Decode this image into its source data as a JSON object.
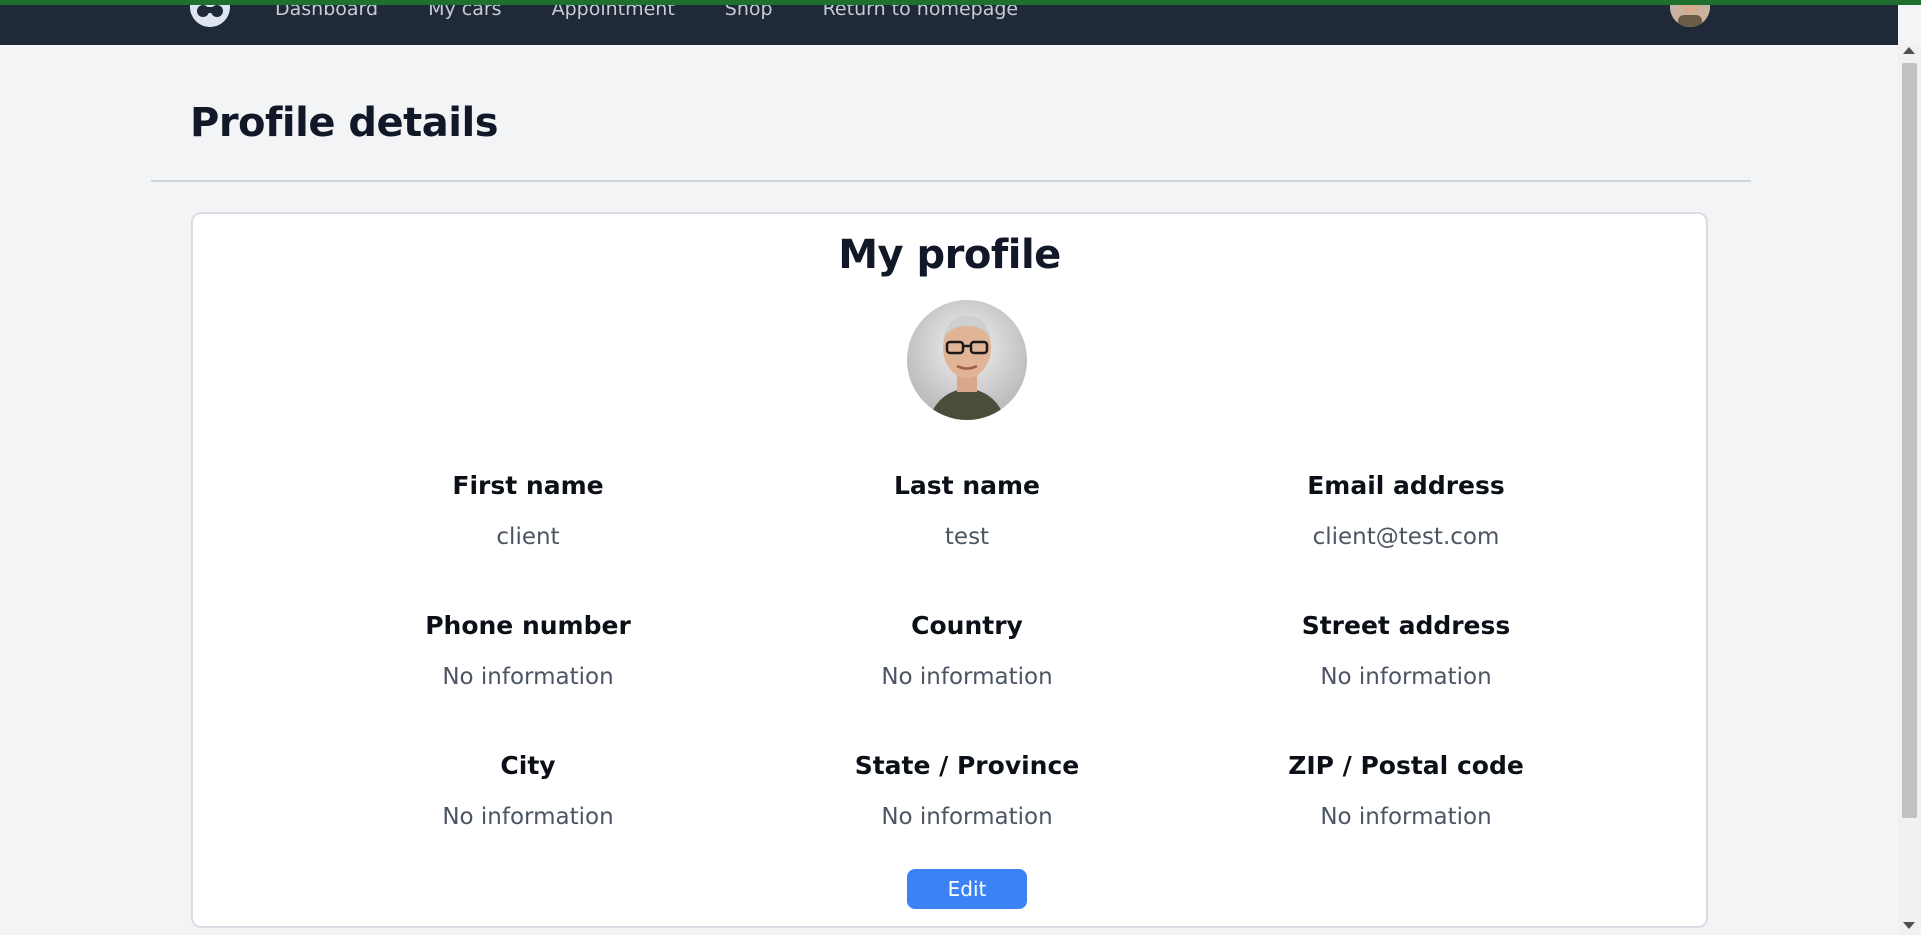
{
  "nav": {
    "items": [
      {
        "label": "Dashboard"
      },
      {
        "label": "My cars"
      },
      {
        "label": "Appointment"
      },
      {
        "label": "Shop"
      },
      {
        "label": "Return to homepage"
      }
    ]
  },
  "page": {
    "title": "Profile details"
  },
  "profile": {
    "heading": "My profile",
    "fields": [
      {
        "label": "First name",
        "value": "client"
      },
      {
        "label": "Last name",
        "value": "test"
      },
      {
        "label": "Email address",
        "value": "client@test.com"
      },
      {
        "label": "Phone number",
        "value": "No information"
      },
      {
        "label": "Country",
        "value": "No information"
      },
      {
        "label": "Street address",
        "value": "No information"
      },
      {
        "label": "City",
        "value": "No information"
      },
      {
        "label": "State / Province",
        "value": "No information"
      },
      {
        "label": "ZIP / Postal code",
        "value": "No information"
      }
    ],
    "edit_label": "Edit"
  },
  "colors": {
    "navbar": "#1f2937",
    "accent_line": "#1f6f2f",
    "edit_button": "#3b82f6",
    "page_background": "#f3f4f6"
  },
  "icons": {
    "logo": "app-logo-icon",
    "user_avatar": "user-avatar",
    "profile_photo": "profile-photo"
  }
}
